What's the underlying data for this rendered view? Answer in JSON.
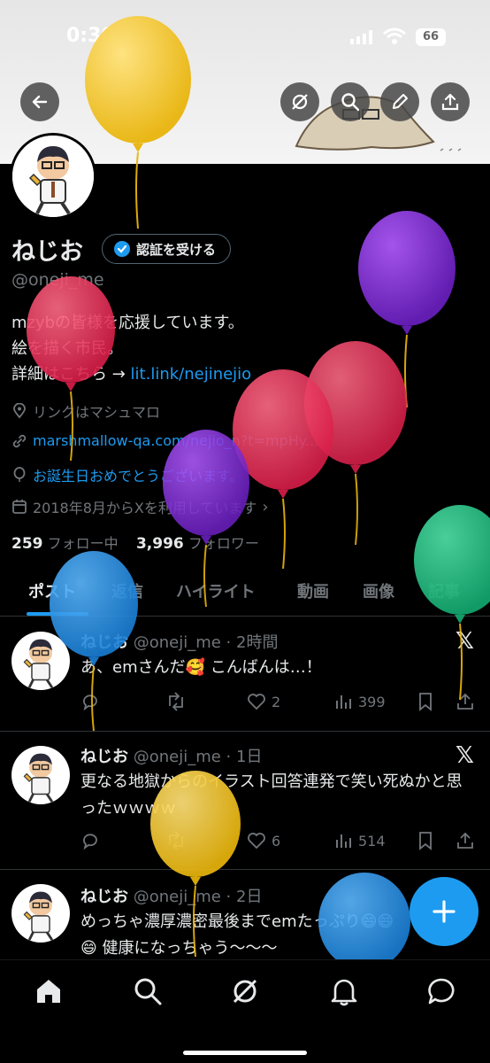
{
  "status_bar": {
    "time": "0:30",
    "battery": "66"
  },
  "profile": {
    "name": "ねじお",
    "verify_label": "認証を受ける",
    "handle": "@oneji_me",
    "bio_line1": "mzybの皆様を応援しています。",
    "bio_line2": "絵を描く市民。",
    "bio_line3_prefix": "詳細はこちら → ",
    "bio_link": "lit.link/nejinejio",
    "location": "リンクはマシュマロ",
    "website": "marshmallow-qa.com/nejio_n?t=mpHy...",
    "birthday": "お誕生日おめでとうございます。",
    "joined": "2018年8月からXを利用しています",
    "following_count": "259",
    "following_label": "フォロー中",
    "followers_count": "3,996",
    "followers_label": "フォロワー"
  },
  "tabs": [
    "ポスト",
    "返信",
    "ハイライト",
    "動画",
    "画像",
    "記事"
  ],
  "posts": [
    {
      "name": "ねじお",
      "meta": "@oneji_me · 2時間",
      "text": "あ、emさんだ🥰 こんばんは…！",
      "likes": "2",
      "views": "399"
    },
    {
      "name": "ねじお",
      "meta": "@oneji_me · 1日",
      "text": "更なる地獄からのイラスト回答連発で笑い死ぬかと思ったｗｗｗｗ",
      "likes": "6",
      "views": "514"
    },
    {
      "name": "ねじお",
      "meta": "@oneji_me · 2日",
      "text": "めっちゃ濃厚濃密最後までemたっぷり😄😄😄 健康になっちゃう〜〜〜"
    }
  ],
  "icons": {
    "back": "arrow-left-icon",
    "grok": "grok-icon",
    "search": "search-icon",
    "edit": "pencil-icon",
    "share": "share-icon",
    "compose": "plus-icon",
    "home": "home-icon",
    "notifications": "bell-icon",
    "messages": "message-icon"
  },
  "colors": {
    "accent": "#1d9bf0",
    "background": "#000000",
    "muted": "#71767b"
  }
}
